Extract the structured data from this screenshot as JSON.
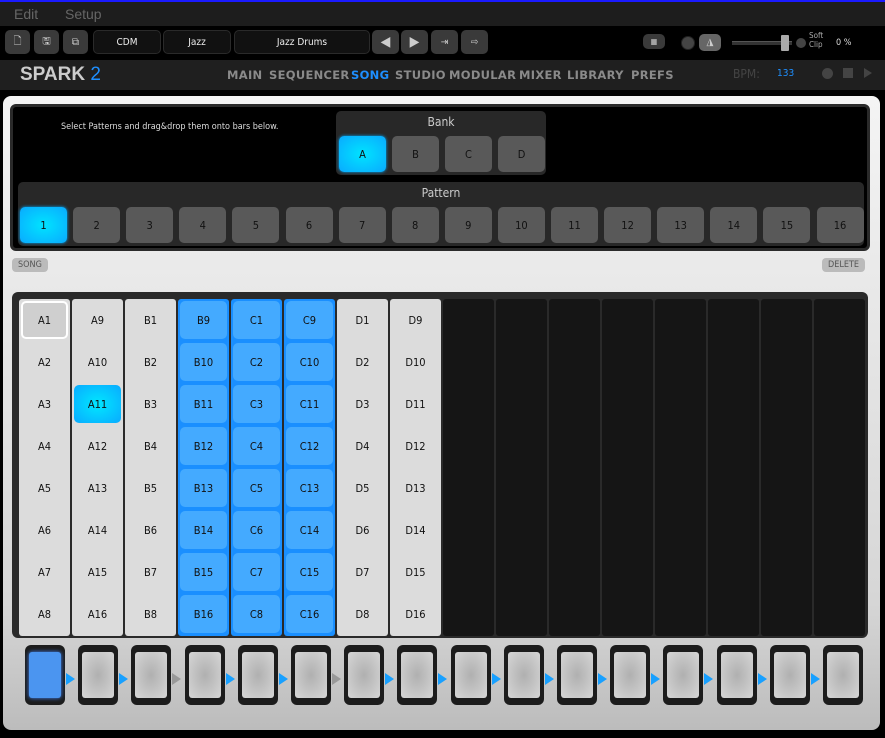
{
  "menu": [
    "Edit",
    "Setup"
  ],
  "toolbar": {
    "fields": [
      "CDM",
      "Jazz",
      "Jazz Drums"
    ],
    "soft_clip": "Soft Clip",
    "clip_value": "0 %"
  },
  "nav": {
    "logo": "SPARK",
    "logo_num": "2",
    "items": [
      "MAIN",
      "SEQUENCER",
      "SONG",
      "STUDIO",
      "MODULAR",
      "MIXER",
      "LIBRARY",
      "PREFS"
    ],
    "active": "SONG",
    "bpm_label": "BPM:",
    "bpm": "133"
  },
  "hint": "Select Patterns and drag&drop them onto bars below.",
  "bank": {
    "title": "Bank",
    "items": [
      "A",
      "B",
      "C",
      "D"
    ],
    "selected": "A"
  },
  "pattern": {
    "title": "Pattern",
    "items": [
      "1",
      "2",
      "3",
      "4",
      "5",
      "6",
      "7",
      "8",
      "9",
      "10",
      "11",
      "12",
      "13",
      "14",
      "15",
      "16"
    ],
    "selected": "1"
  },
  "song_label": "SONG",
  "delete_label": "DELETE",
  "colors": {
    "accent": "#1e8fff",
    "selected": "#00d8ff"
  },
  "grid": {
    "columns": [
      [
        "A1",
        "A2",
        "A3",
        "A4",
        "A5",
        "A6",
        "A7",
        "A8"
      ],
      [
        "A9",
        "A10",
        "A11",
        "A12",
        "A13",
        "A14",
        "A15",
        "A16"
      ],
      [
        "B1",
        "B2",
        "B3",
        "B4",
        "B5",
        "B6",
        "B7",
        "B8"
      ],
      [
        "B9",
        "B10",
        "B11",
        "B12",
        "B13",
        "B14",
        "B15",
        "B16"
      ],
      [
        "C1",
        "C2",
        "C3",
        "C4",
        "C5",
        "C6",
        "C7",
        "C8"
      ],
      [
        "C9",
        "C10",
        "C11",
        "C12",
        "C13",
        "C14",
        "C15",
        "C16"
      ],
      [
        "D1",
        "D2",
        "D3",
        "D4",
        "D5",
        "D6",
        "D7",
        "D8"
      ],
      [
        "D9",
        "D10",
        "D11",
        "D12",
        "D13",
        "D14",
        "D15",
        "D16"
      ],
      [],
      [],
      [],
      [],
      [],
      [],
      [],
      []
    ],
    "highlighted_columns": [
      3,
      4,
      5
    ],
    "current_cell": "A1",
    "selected_cell": "A11"
  },
  "bars": {
    "count": 16,
    "active": [
      1
    ],
    "arrows_off_after": [
      3,
      6
    ]
  }
}
